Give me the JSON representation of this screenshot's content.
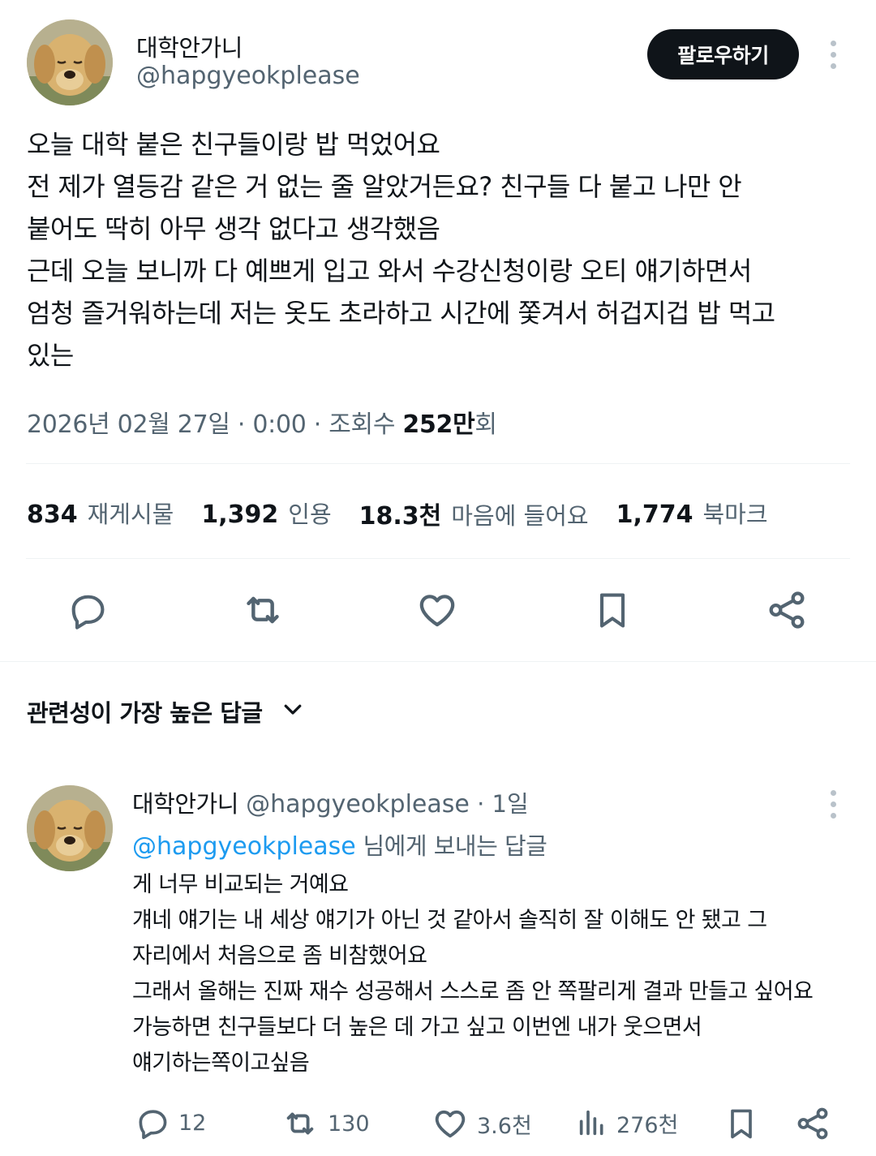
{
  "tweet": {
    "author_name": "대학안가니",
    "author_handle": "@hapgyeokplease",
    "follow_label": "팔로우하기",
    "text_lines": [
      "오늘 대학 붙은 친구들이랑 밥 먹었어요",
      "전 제가 열등감 같은 거 없는 줄 알았거든요? 친구들 다 붙고 나만 안",
      "붙어도 딱히 아무 생각 없다고 생각했음",
      "근데 오늘 보니까 다 예쁘게 입고 와서 수강신청이랑 오티 얘기하면서",
      "엄청 즐거워하는데 저는 옷도 초라하고 시간에 쫓겨서 허겁지겁 밥 먹고",
      "있는"
    ],
    "meta_prefix": "2026년 02월 27일 · 0:00 · 조회수 ",
    "views_value": "252만",
    "views_suffix": "회",
    "stats": [
      {
        "value": "834",
        "label": "재게시물"
      },
      {
        "value": "1,392",
        "label": "인용"
      },
      {
        "value": "18.3천",
        "label": "마음에 들어요"
      },
      {
        "value": "1,774",
        "label": "북마크"
      }
    ],
    "actions": [
      "reply-icon",
      "retweet-icon",
      "like-icon",
      "bookmark-icon",
      "share-icon"
    ]
  },
  "replies_section": {
    "title": "관련성이 가장 높은 답글"
  },
  "reply": {
    "author_name": "대학안가니",
    "author_handle": "@hapgyeokplease",
    "time": "· 1일",
    "replying_to_handle": "@hapgyeokplease",
    "replying_to_suffix": " 님에게 보내는 답글",
    "text_lines": [
      "게 너무 비교되는 거예요",
      "걔네 얘기는 내 세상 얘기가 아닌 것 같아서 솔직히 잘 이해도 안 됐고 그",
      "자리에서 처음으로 좀 비참했어요",
      "그래서 올해는 진짜 재수 성공해서 스스로 좀 안 쪽팔리게 결과 만들고 싶어요",
      "가능하면 친구들보다 더 높은 데 가고 싶고 이번엔 내가 웃으면서",
      "얘기하는쪽이고싶음"
    ],
    "counts": {
      "replies": "12",
      "retweets": "130",
      "likes": "3.6천",
      "views": "276천"
    }
  },
  "colors": {
    "text": "#0f1419",
    "secondary": "#536471",
    "link": "#1d9bf0",
    "divider": "#eff3f4"
  }
}
